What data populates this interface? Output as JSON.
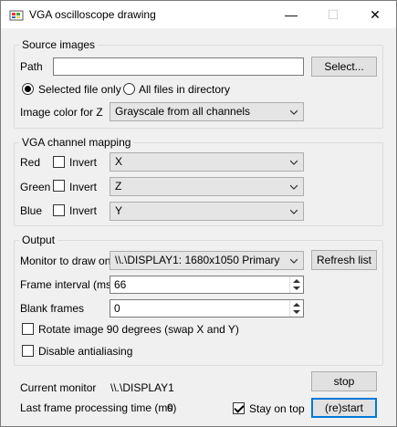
{
  "window": {
    "title": "VGA oscilloscope drawing",
    "minimize_glyph": "—",
    "maximize_glyph": "☐",
    "close_glyph": "✕"
  },
  "source": {
    "group_title": "Source images",
    "path_label": "Path",
    "path_value": "",
    "select_button": "Select...",
    "radio_selected_file": "Selected file only",
    "radio_all_files": "All files in directory",
    "selected_radio": "selected_file",
    "image_color_label": "Image color for Z",
    "image_color_value": "Grayscale from all channels"
  },
  "mapping": {
    "group_title": "VGA channel mapping",
    "invert_label": "Invert",
    "channels": [
      {
        "label": "Red",
        "invert": false,
        "value": "X"
      },
      {
        "label": "Green",
        "invert": false,
        "value": "Z"
      },
      {
        "label": "Blue",
        "invert": false,
        "value": "Y"
      }
    ]
  },
  "output": {
    "group_title": "Output",
    "monitor_label": "Monitor to draw on",
    "monitor_value": "\\\\.\\DISPLAY1: 1680x1050 Primary",
    "refresh_button": "Refresh list",
    "frame_interval_label": "Frame interval (ms)",
    "frame_interval_value": "66",
    "blank_frames_label": "Blank frames",
    "blank_frames_value": "0",
    "rotate_label": "Rotate image 90 degrees (swap X and Y)",
    "rotate_checked": false,
    "antialias_label": "Disable antialiasing",
    "antialias_checked": false
  },
  "status": {
    "current_monitor_label": "Current monitor",
    "current_monitor_value": "\\\\.\\DISPLAY1",
    "last_frame_label": "Last frame processing time (ms)",
    "last_frame_value": "0",
    "stop_button": "stop",
    "stay_on_top_label": "Stay on top",
    "stay_on_top_checked": true,
    "restart_button": "(re)start"
  },
  "colors": {
    "window_bg": "#f0f0f0",
    "accent": "#0078d7",
    "button_bg": "#e1e1e1"
  },
  "icons": [
    "app-icon",
    "minimize-icon",
    "maximize-icon",
    "close-icon",
    "chevron-down-icon"
  ]
}
